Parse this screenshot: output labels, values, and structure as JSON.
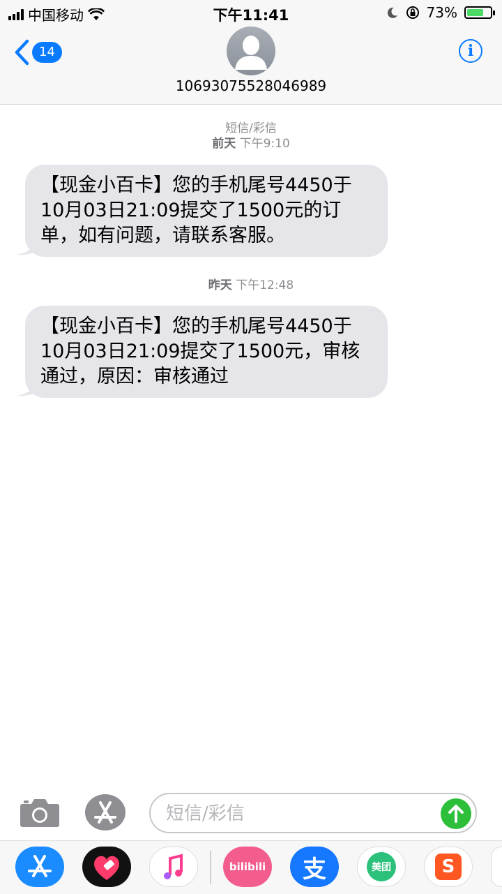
{
  "status_bar": {
    "carrier": "中国移动",
    "time": "下午11:41",
    "battery_percent": "73%",
    "battery_level": 0.73
  },
  "header": {
    "back_badge": "14",
    "contact": "10693075528046989",
    "info_icon_text": "i"
  },
  "messages": [
    {
      "meta_type": "短信/彩信",
      "meta_day": "前天",
      "meta_time": "下午9:10",
      "text": "【现金小百卡】您的手机尾号4450于10月03日21:09提交了1500元的订单，如有问题，请联系客服。"
    },
    {
      "meta_day": "昨天",
      "meta_time": "下午12:48",
      "text": "【现金小百卡】您的手机尾号4450于10月03日21:09提交了1500元，审核通过，原因：审核通过"
    }
  ],
  "input": {
    "placeholder": "短信/彩信",
    "value": ""
  },
  "drawer": {
    "apps": [
      {
        "name": "app-store",
        "color": "#1a8cff"
      },
      {
        "name": "heart-sticker",
        "color": "#111111"
      },
      {
        "name": "music",
        "color": "#ffffff"
      },
      {
        "name": "bilibili",
        "label": "bilibili",
        "color": "#f25d8e"
      },
      {
        "name": "alipay",
        "label": "支",
        "color": "#1677ff"
      },
      {
        "name": "meituan",
        "label": "美团",
        "color": "#2cc17a"
      },
      {
        "name": "sogou",
        "label": "S",
        "color": "#ff5722"
      }
    ]
  }
}
